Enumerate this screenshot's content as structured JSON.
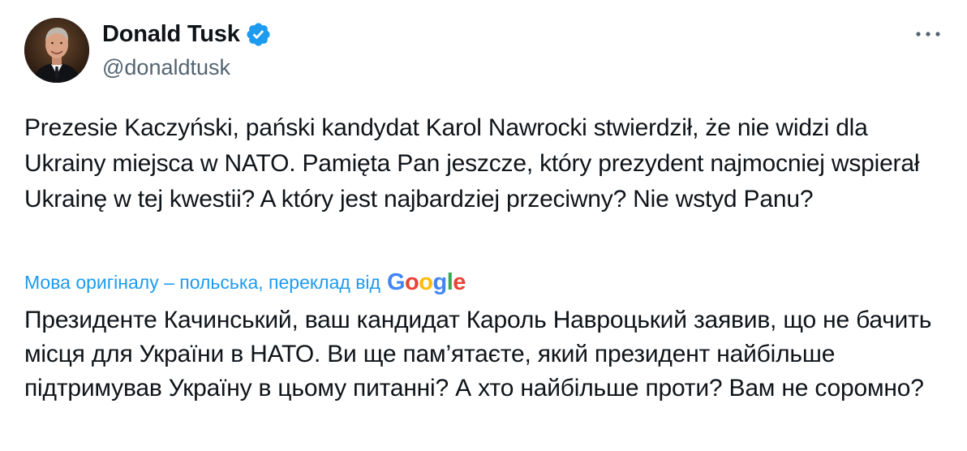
{
  "author": {
    "name": "Donald Tusk",
    "handle": "@donaldtusk",
    "verified": true
  },
  "icons": {
    "verified": "verified-badge-icon",
    "more": "more-dots-icon"
  },
  "colors": {
    "accent": "#1d9bf0",
    "text": "#0f1419",
    "secondary": "#536471"
  },
  "tweet": {
    "original_text": "Prezesie Kaczyński, pański kandydat Karol Nawrocki stwierdził, że nie widzi dla Ukrainy miejsca w NATO. Pamięta Pan jeszcze, który prezydent najmocniej wspierał Ukrainę w tej kwestii? A który jest najbardziej przeciwny? Nie wstyd Panu?",
    "translation_label": "Мова оригіналу – польська, переклад від",
    "translation_provider": "Google",
    "translated_text": "Президенте Качинський, ваш кандидат Кароль Навроцький заявив, що не бачить місця для України в НАТО. Ви ще пам’ятаєте, який президент найбільше підтримував Україну в цьому питанні? А хто найбільше проти? Вам не соромно?"
  }
}
